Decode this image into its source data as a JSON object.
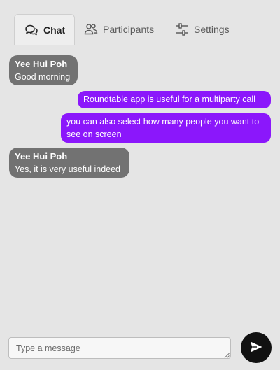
{
  "tabs": [
    {
      "label": "Chat",
      "icon": "chat-bubbles-icon",
      "active": true
    },
    {
      "label": "Participants",
      "icon": "users-icon",
      "active": false
    },
    {
      "label": "Settings",
      "icon": "sliders-icon",
      "active": false
    }
  ],
  "messages": [
    {
      "direction": "incoming",
      "sender": "Yee Hui Poh",
      "text": "Good morning"
    },
    {
      "direction": "outgoing",
      "text": "Roundtable app is useful for a multiparty call"
    },
    {
      "direction": "outgoing",
      "text": "you can also select how many people you want to see on screen"
    },
    {
      "direction": "incoming",
      "sender": "Yee Hui Poh",
      "text": "Yes, it is very useful indeed"
    }
  ],
  "composer": {
    "placeholder": "Type a message",
    "value": "",
    "send_icon": "send-icon"
  },
  "colors": {
    "background": "#e5e5e5",
    "incoming_bubble": "#727272",
    "outgoing_bubble": "#8b17fb",
    "send_button": "#111111"
  }
}
